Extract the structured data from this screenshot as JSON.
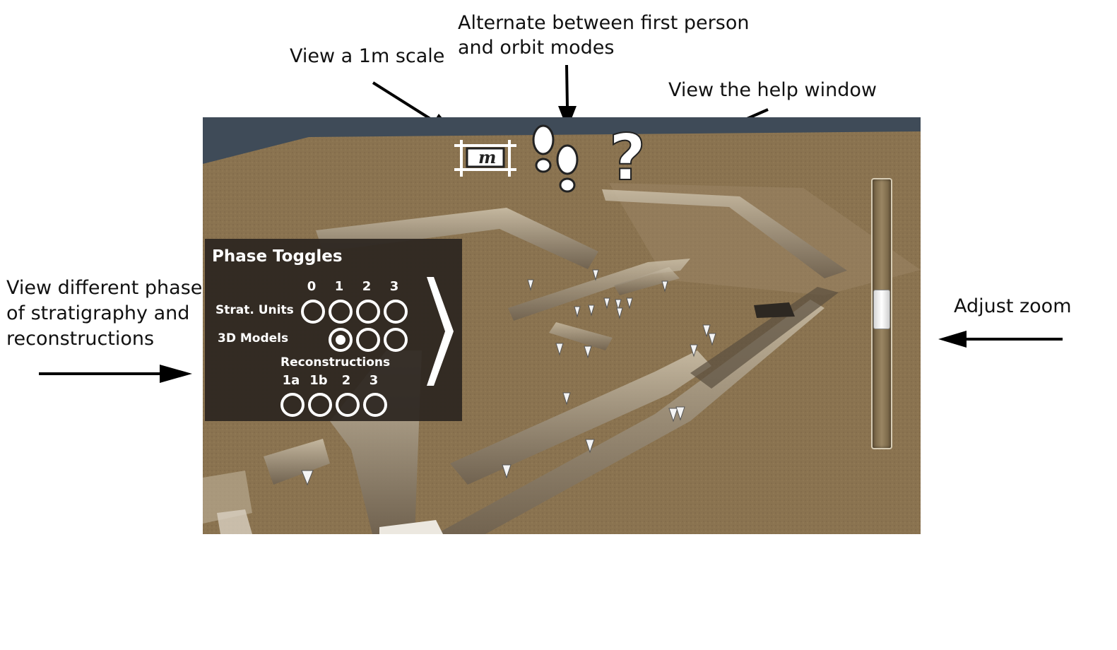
{
  "annotations": {
    "scale": "View a 1m scale",
    "mode_line1": "Alternate between first person",
    "mode_line2": "and orbit modes",
    "help": "View the help window",
    "phases_line1": "View different phases",
    "phases_line2": "of stratigraphy and",
    "phases_line3": "reconstructions",
    "zoom": "Adjust zoom"
  },
  "phase_toggles": {
    "title": "Phase Toggles",
    "phase_numbers": [
      "0",
      "1",
      "2",
      "3"
    ],
    "strat_units_label": "Strat. Units",
    "models_label": "3D Models",
    "reconstructions_label": "Reconstructions",
    "reconstruction_ids": [
      "1a",
      "1b",
      "2",
      "3"
    ],
    "models_selected": "1"
  },
  "toolbar": {
    "scale_icon_letter": "m",
    "help_glyph": "?"
  },
  "zoom": {
    "level_fraction": 0.52
  },
  "colors": {
    "ground": "#8a7350",
    "sky": "#3f4b58",
    "panel": "#2c2620"
  }
}
